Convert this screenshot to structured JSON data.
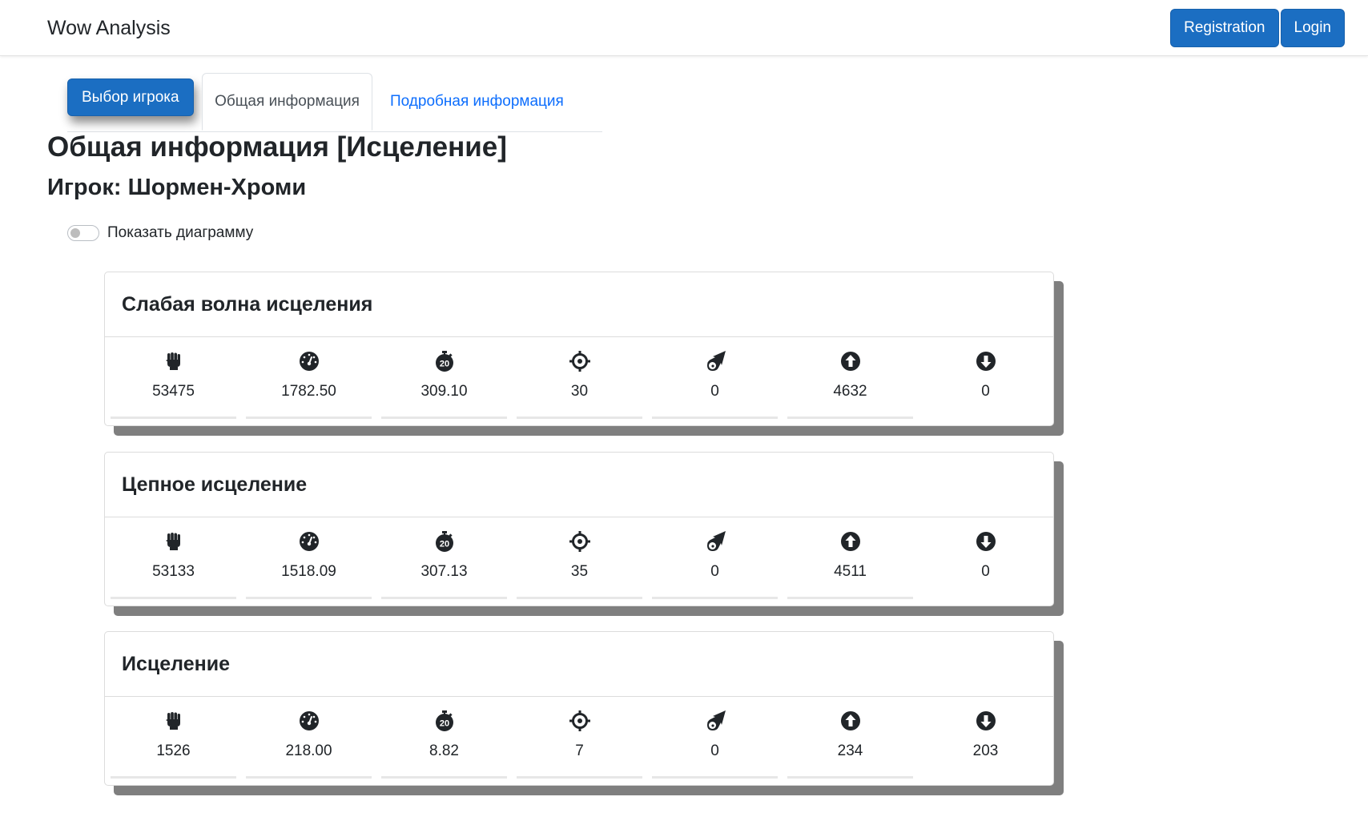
{
  "navbar": {
    "brand": "Wow Analysis",
    "registration_label": "Registration",
    "login_label": "Login"
  },
  "tabs": {
    "select_player_label": "Выбор игрока",
    "general_label": "Общая информация",
    "detail_label": "Подробная информация"
  },
  "main": {
    "title": "Общая информация [Исцеление]",
    "player": "Игрок: Шормен-Хроми",
    "show_chart_label": "Показать диаграмму",
    "show_chart_checked": false
  },
  "stat_icons": [
    "fist-icon",
    "gauge-icon",
    "stopwatch-icon",
    "crosshair-icon",
    "comet-icon",
    "arrow-up-circle-icon",
    "arrow-down-circle-icon"
  ],
  "cards": [
    {
      "title": "Слабая волна исцеления",
      "values": [
        "53475",
        "1782.50",
        "309.10",
        "30",
        "0",
        "4632",
        "0"
      ]
    },
    {
      "title": "Цепное исцеление",
      "values": [
        "53133",
        "1518.09",
        "307.13",
        "35",
        "0",
        "4511",
        "0"
      ]
    },
    {
      "title": "Исцеление",
      "values": [
        "1526",
        "218.00",
        "8.82",
        "7",
        "0",
        "234",
        "203"
      ]
    }
  ],
  "colors": {
    "primary": "#1b6ec2",
    "link": "#0d6efd",
    "card_shadow": "#7f7f7f"
  }
}
